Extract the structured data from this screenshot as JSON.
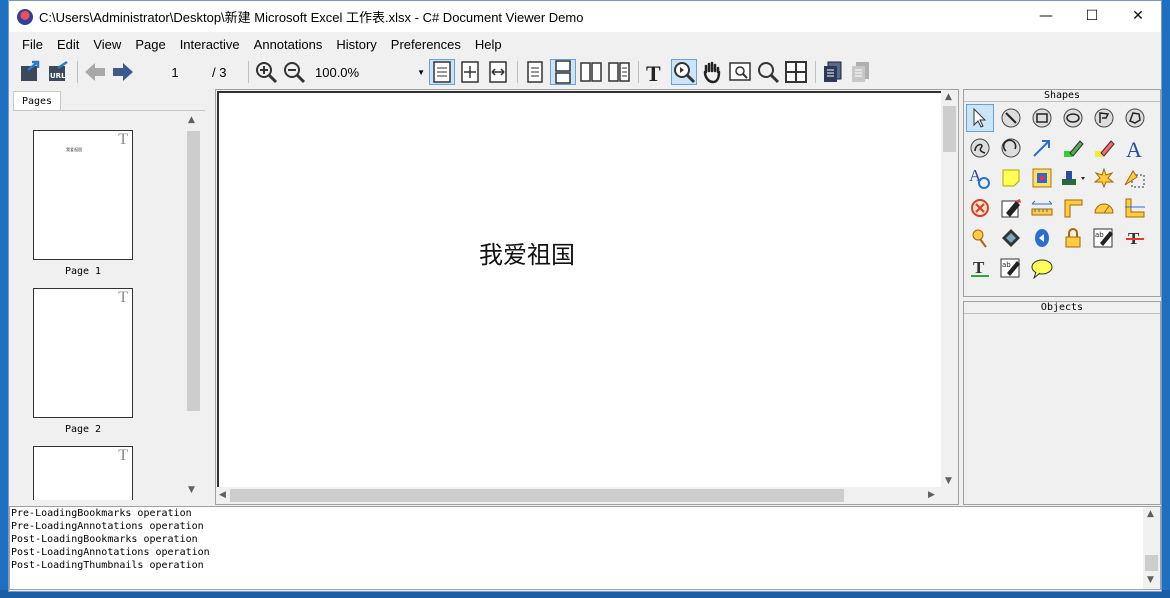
{
  "window": {
    "title": "C:\\Users\\Administrator\\Desktop\\新建 Microsoft Excel 工作表.xlsx - C# Document Viewer Demo",
    "controls": {
      "minimize": "—",
      "maximize": "☐",
      "close": "✕"
    }
  },
  "menu": [
    {
      "label": "File"
    },
    {
      "label": "Edit"
    },
    {
      "label": "View"
    },
    {
      "label": "Page"
    },
    {
      "label": "Interactive"
    },
    {
      "label": "Annotations"
    },
    {
      "label": "History"
    },
    {
      "label": "Preferences"
    },
    {
      "label": "Help"
    }
  ],
  "toolbar": {
    "page_current": "1",
    "page_total": "/ 3",
    "zoom_value": "100.0%"
  },
  "pages_panel": {
    "tab_label": "Pages",
    "thumbnails": [
      {
        "label": "Page 1",
        "marker": "T",
        "text": "我爱祖国"
      },
      {
        "label": "Page 2",
        "marker": "T"
      },
      {
        "marker": "T"
      }
    ]
  },
  "document": {
    "text": "我爱祖国"
  },
  "shapes_panel": {
    "title": "Shapes",
    "tools": [
      "pointer-icon",
      "line-icon",
      "rectangle-icon",
      "ellipse-icon",
      "polygon-icon",
      "polyline-icon",
      "curve-icon",
      "arc-icon",
      "arrow-icon",
      "highlighter-icon",
      "pencil-icon",
      "text-icon",
      "text-link-icon",
      "sticky-note-icon",
      "image-icon",
      "stamp-icon",
      "burst-icon",
      "ruler-area-icon",
      "erase-icon",
      "marker-icon",
      "measure-icon",
      "angle-icon",
      "protractor-icon",
      "ruler-icon",
      "pin-icon",
      "film-icon",
      "sound-icon",
      "lock-icon",
      "replace-text-icon",
      "strikeout-icon",
      "underline-icon",
      "insert-text-icon",
      "callout-icon"
    ]
  },
  "objects_panel": {
    "title": "Objects"
  },
  "log": {
    "lines": [
      "Pre-LoadingBookmarks operation",
      "Pre-LoadingAnnotations operation",
      "Post-LoadingBookmarks operation",
      "Post-LoadingAnnotations operation",
      "Post-LoadingThumbnails operation"
    ]
  }
}
